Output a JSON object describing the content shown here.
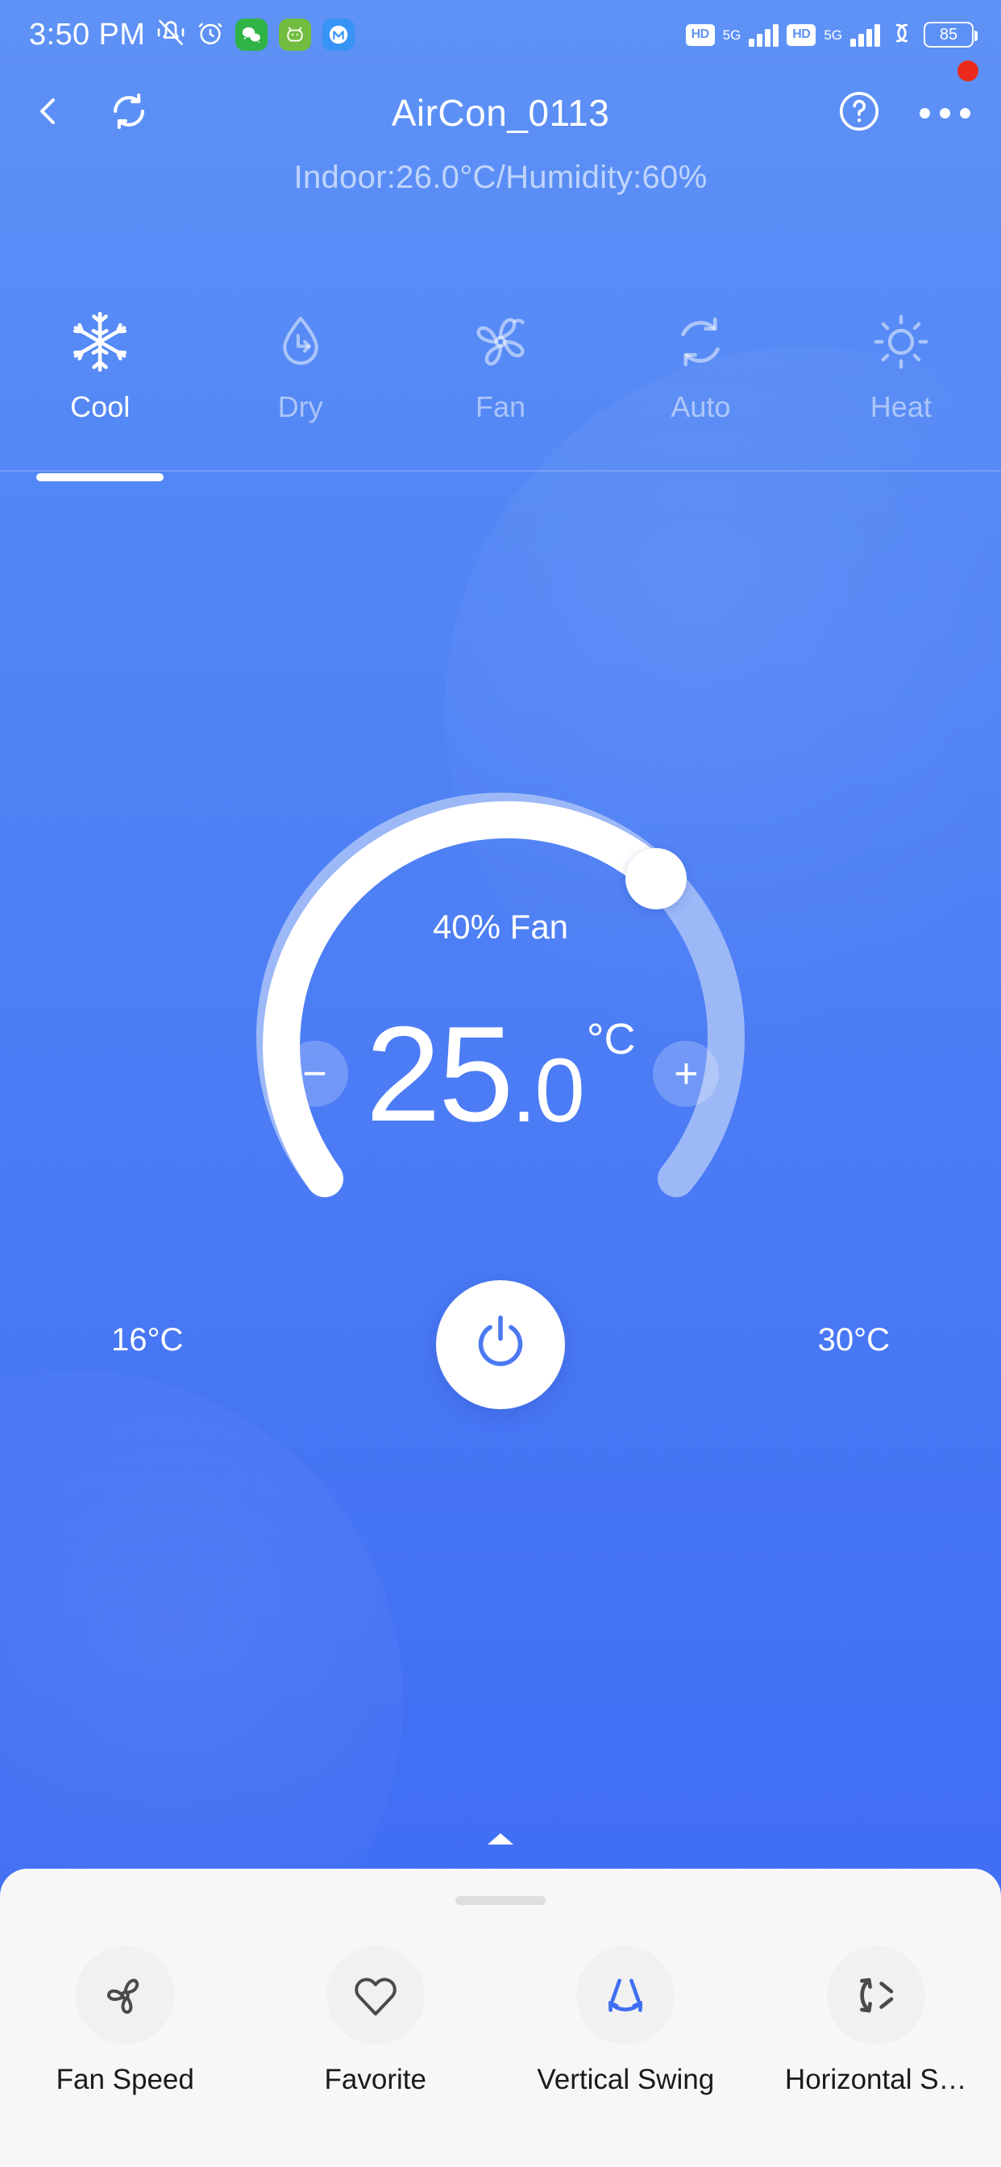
{
  "statusbar": {
    "time": "3:50 PM",
    "icons_left": [
      "vibrate-off-icon",
      "alarm-icon",
      "wechat-icon",
      "app-green-icon",
      "app-blue-icon"
    ],
    "hd_label": "HD",
    "network_label": "5G",
    "battery_level": "85",
    "icons_right": [
      "hd-icon",
      "5g-signal-icon",
      "hd-icon",
      "5g-signal-icon",
      "vpn-icon",
      "battery-icon"
    ]
  },
  "navbar": {
    "back_icon": "chevron-left-icon",
    "refresh_icon": "refresh-icon",
    "title": "AirCon_0113",
    "help_icon": "help-circle-icon",
    "more_icon": "more-horizontal-icon",
    "has_notification_badge": true
  },
  "header": {
    "subtitle": "Indoor:26.0°C/Humidity:60%"
  },
  "modes": {
    "active_index": 0,
    "items": [
      {
        "label": "Cool",
        "icon": "snowflake-icon"
      },
      {
        "label": "Dry",
        "icon": "water-drop-icon"
      },
      {
        "label": "Fan",
        "icon": "fan-blades-icon"
      },
      {
        "label": "Auto",
        "icon": "auto-cycle-icon"
      },
      {
        "label": "Heat",
        "icon": "sun-icon"
      }
    ]
  },
  "dial": {
    "fan_label": "40% Fan",
    "temp_integer": "25",
    "temp_decimal": ".0",
    "temp_unit": "°C",
    "min_label": "16°C",
    "max_label": "30°C",
    "decrease_symbol": "−",
    "increase_symbol": "+",
    "power_icon": "power-icon",
    "track_color": "#ffffff",
    "track_inactive_color": "#9cb8f7",
    "progress_percent": 60
  },
  "sheet": {
    "expand_caret": "caret-up-icon",
    "grabber": "drag-handle",
    "actions": [
      {
        "label": "Fan Speed",
        "icon": "fan-speed-icon",
        "active": false
      },
      {
        "label": "Favorite",
        "icon": "heart-icon",
        "active": false
      },
      {
        "label": "Vertical Swing",
        "icon": "vertical-swing-icon",
        "active": true
      },
      {
        "label": "Horizontal S…",
        "icon": "horizontal-swing-icon",
        "active": false
      }
    ],
    "active_color": "#3f6ef0",
    "inactive_color": "#4a4a4a"
  }
}
